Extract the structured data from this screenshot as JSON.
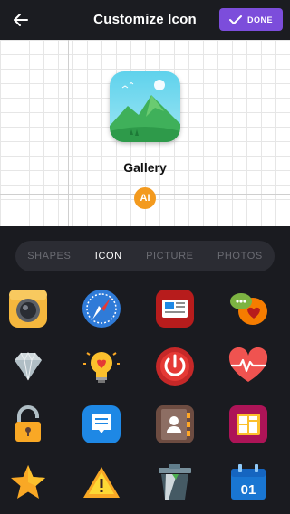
{
  "header": {
    "title": "Customize Icon",
    "done_label": "DONE",
    "accent": "#7c4ddb"
  },
  "preview": {
    "app_name": "Gallery",
    "icon": "gallery-mountain-icon",
    "badge_label": "AI",
    "badge_color": "#f39a1e"
  },
  "tabs": [
    {
      "label": "SHAPES",
      "active": false
    },
    {
      "label": "ICON",
      "active": true
    },
    {
      "label": "PICTURE",
      "active": false
    },
    {
      "label": "PHOTOS",
      "active": false
    }
  ],
  "icon_grid": [
    "camera-icon",
    "compass-icon",
    "news-icon",
    "chat-bubbles-icon",
    "diamond-icon",
    "lightbulb-heart-icon",
    "power-icon",
    "heartbeat-icon",
    "padlock-icon",
    "message-icon",
    "contacts-book-icon",
    "media-folder-icon",
    "star-icon",
    "warning-icon",
    "trash-icon",
    "calendar-icon"
  ],
  "calendar_day": "01"
}
